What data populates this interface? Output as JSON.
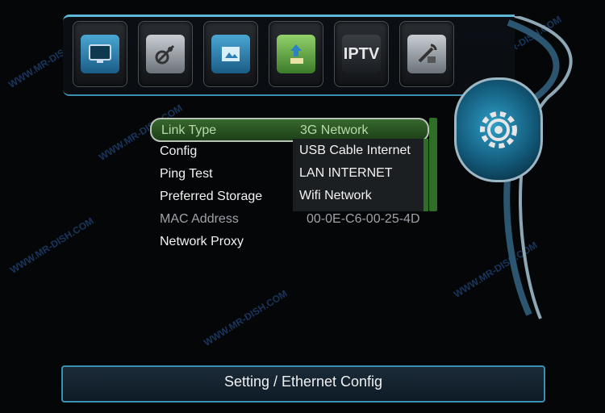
{
  "watermark": "WWW.MR-DISH.COM",
  "top_icons": [
    {
      "name": "tv-icon"
    },
    {
      "name": "satellite-dish-icon"
    },
    {
      "name": "media-icon"
    },
    {
      "name": "usb-upgrade-icon"
    },
    {
      "name": "iptv-icon",
      "label": "IPTV"
    },
    {
      "name": "tools-icon"
    }
  ],
  "menu": {
    "items": [
      {
        "label": "Link Type",
        "value": "3G Network",
        "state": "selected"
      },
      {
        "label": "Config",
        "value": "",
        "state": "normal"
      },
      {
        "label": "Ping Test",
        "value": "",
        "state": "normal"
      },
      {
        "label": "Preferred Storage",
        "value": "",
        "state": "normal"
      },
      {
        "label": "MAC Address",
        "value": "00-0E-C6-00-25-4D",
        "state": "disabled"
      },
      {
        "label": "Network Proxy",
        "value": "",
        "state": "normal"
      }
    ]
  },
  "dropdown": {
    "options": [
      "USB Cable Internet",
      "LAN INTERNET",
      "Wifi Network"
    ]
  },
  "footer": {
    "title": "Setting / Ethernet Config"
  },
  "colors": {
    "accent_blue": "#3b8fb3",
    "selection_green": "#37682e",
    "background": "#050608"
  }
}
